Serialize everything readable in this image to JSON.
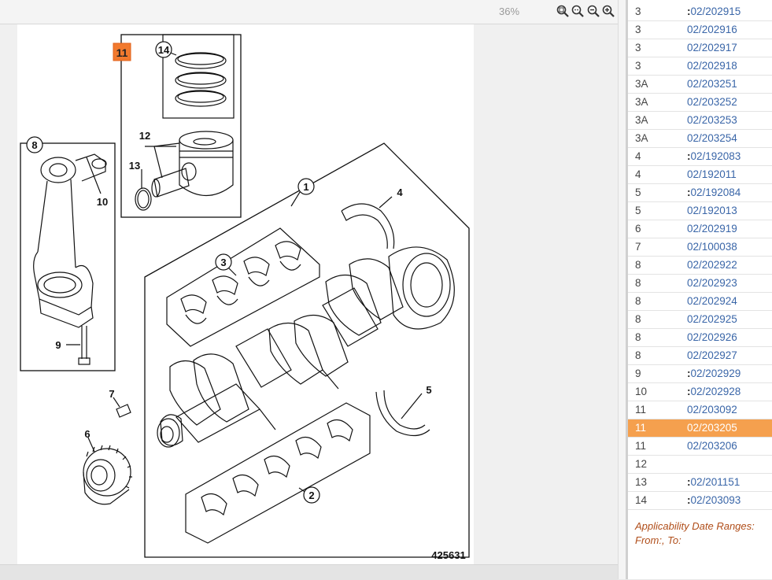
{
  "toolbar": {
    "zoom": "36%",
    "buttons": [
      {
        "name": "zoom-fit-icon"
      },
      {
        "name": "zoom-actual-icon"
      },
      {
        "name": "zoom-out-icon"
      },
      {
        "name": "zoom-in-icon"
      }
    ]
  },
  "diagram": {
    "drawing_number": "425631",
    "selected_callout": "11",
    "callouts": [
      "1",
      "2",
      "3",
      "4",
      "5",
      "6",
      "7",
      "8",
      "9",
      "10",
      "11",
      "12",
      "13",
      "14"
    ]
  },
  "parts": [
    {
      "item": "3",
      "part": "02/202915",
      "flag": true
    },
    {
      "item": "3",
      "part": "02/202916",
      "flag": false
    },
    {
      "item": "3",
      "part": "02/202917",
      "flag": false
    },
    {
      "item": "3",
      "part": "02/202918",
      "flag": false
    },
    {
      "item": "3A",
      "part": "02/203251",
      "flag": false
    },
    {
      "item": "3A",
      "part": "02/203252",
      "flag": false
    },
    {
      "item": "3A",
      "part": "02/203253",
      "flag": false
    },
    {
      "item": "3A",
      "part": "02/203254",
      "flag": false
    },
    {
      "item": "4",
      "part": "02/192083",
      "flag": true
    },
    {
      "item": "4",
      "part": "02/192011",
      "flag": false
    },
    {
      "item": "5",
      "part": "02/192084",
      "flag": true
    },
    {
      "item": "5",
      "part": "02/192013",
      "flag": false
    },
    {
      "item": "6",
      "part": "02/202919",
      "flag": false
    },
    {
      "item": "7",
      "part": "02/100038",
      "flag": false
    },
    {
      "item": "8",
      "part": "02/202922",
      "flag": false
    },
    {
      "item": "8",
      "part": "02/202923",
      "flag": false
    },
    {
      "item": "8",
      "part": "02/202924",
      "flag": false
    },
    {
      "item": "8",
      "part": "02/202925",
      "flag": false
    },
    {
      "item": "8",
      "part": "02/202926",
      "flag": false
    },
    {
      "item": "8",
      "part": "02/202927",
      "flag": false
    },
    {
      "item": "9",
      "part": "02/202929",
      "flag": true
    },
    {
      "item": "10",
      "part": "02/202928",
      "flag": true
    },
    {
      "item": "11",
      "part": "02/203092",
      "flag": false
    },
    {
      "item": "11",
      "part": "02/203205",
      "flag": false,
      "selected": true
    },
    {
      "item": "11",
      "part": "02/203206",
      "flag": false
    },
    {
      "item": "12",
      "part": "",
      "flag": false
    },
    {
      "item": "13",
      "part": "02/201151",
      "flag": true
    },
    {
      "item": "14",
      "part": "02/203093",
      "flag": true
    }
  ],
  "applicability": {
    "title": "Applicability Date Ranges:",
    "range": "From:, To:"
  },
  "colors": {
    "selected": "#f5a04e",
    "link": "#3a66a8",
    "applicability_text": "#b04e1a"
  }
}
